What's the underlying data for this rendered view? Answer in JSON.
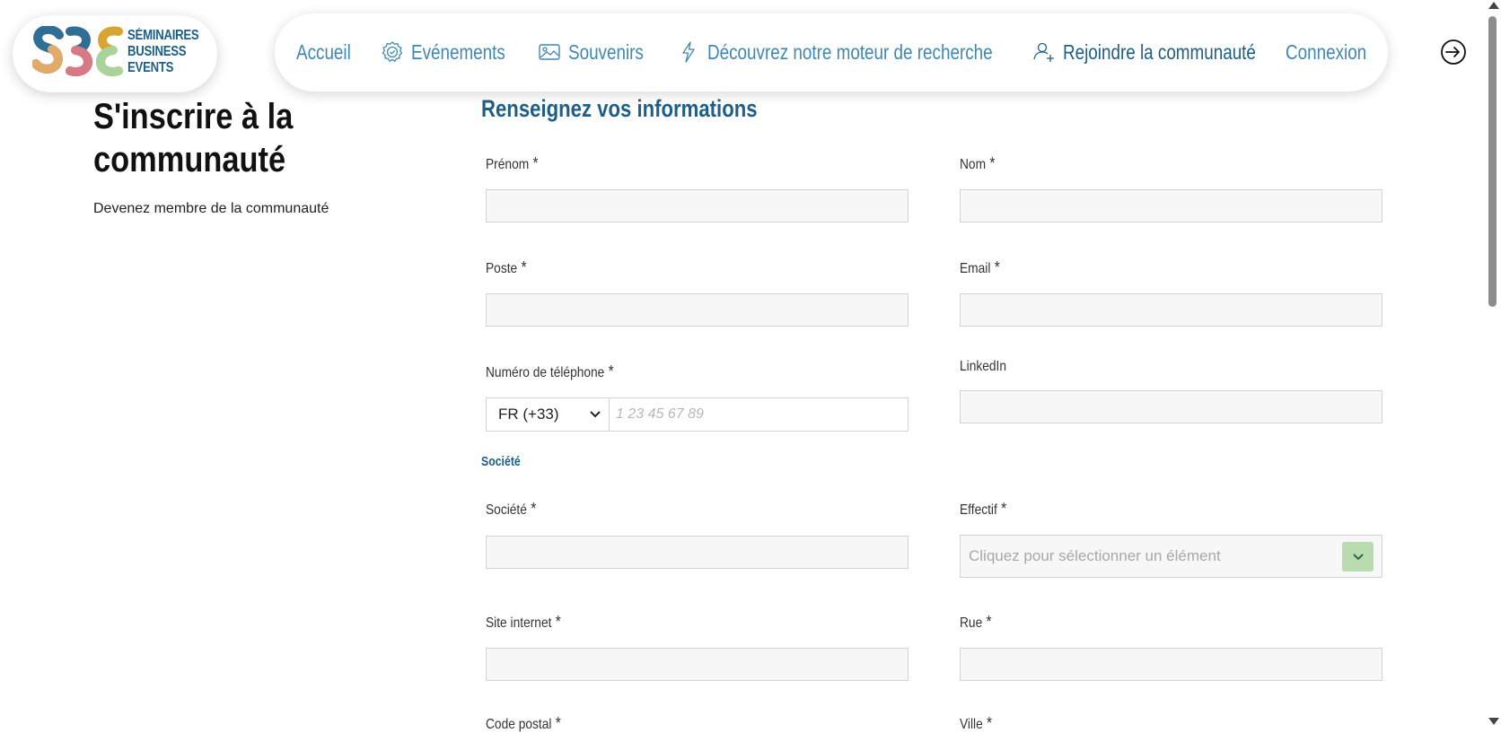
{
  "logo": {
    "name": "SBE",
    "line1": "SÉMINAIRES",
    "line2": "BUSINESS",
    "line3": "EVENTS"
  },
  "nav": {
    "items": [
      {
        "label": "Accueil",
        "icon": ""
      },
      {
        "label": "Evénements",
        "icon": "badge-icon"
      },
      {
        "label": "Souvenirs",
        "icon": "image-icon"
      },
      {
        "label": "Découvrez notre moteur de recherche",
        "icon": "lightning-icon"
      },
      {
        "label": "Rejoindre la communauté",
        "icon": "user-plus-icon"
      },
      {
        "label": "Connexion",
        "icon": ""
      }
    ],
    "login_icon": "login-icon"
  },
  "page": {
    "title": "S'inscrire à la communauté",
    "subtitle": "Devenez membre de la communauté"
  },
  "form": {
    "section_title": "Renseignez vos informations",
    "company_section": "Société",
    "required_mark": "*",
    "fields": {
      "prenom": "Prénom",
      "nom": "Nom",
      "poste": "Poste",
      "email": "Email",
      "telephone": "Numéro de téléphone",
      "linkedin": "LinkedIn",
      "societe": "Société",
      "effectif": "Effectif",
      "site": "Site internet",
      "rue": "Rue",
      "code_postal": "Code postal",
      "ville": "Ville"
    },
    "phone_country": "FR (+33)",
    "phone_placeholder": "1 23 45 67 89",
    "effectif_placeholder": "Cliquez pour sélectionner un élément"
  },
  "colors": {
    "primary": "#1d5f86",
    "nav_link": "#3e88b3",
    "input_bg": "#f7f7f7",
    "select_button": "#b9dbb0"
  }
}
